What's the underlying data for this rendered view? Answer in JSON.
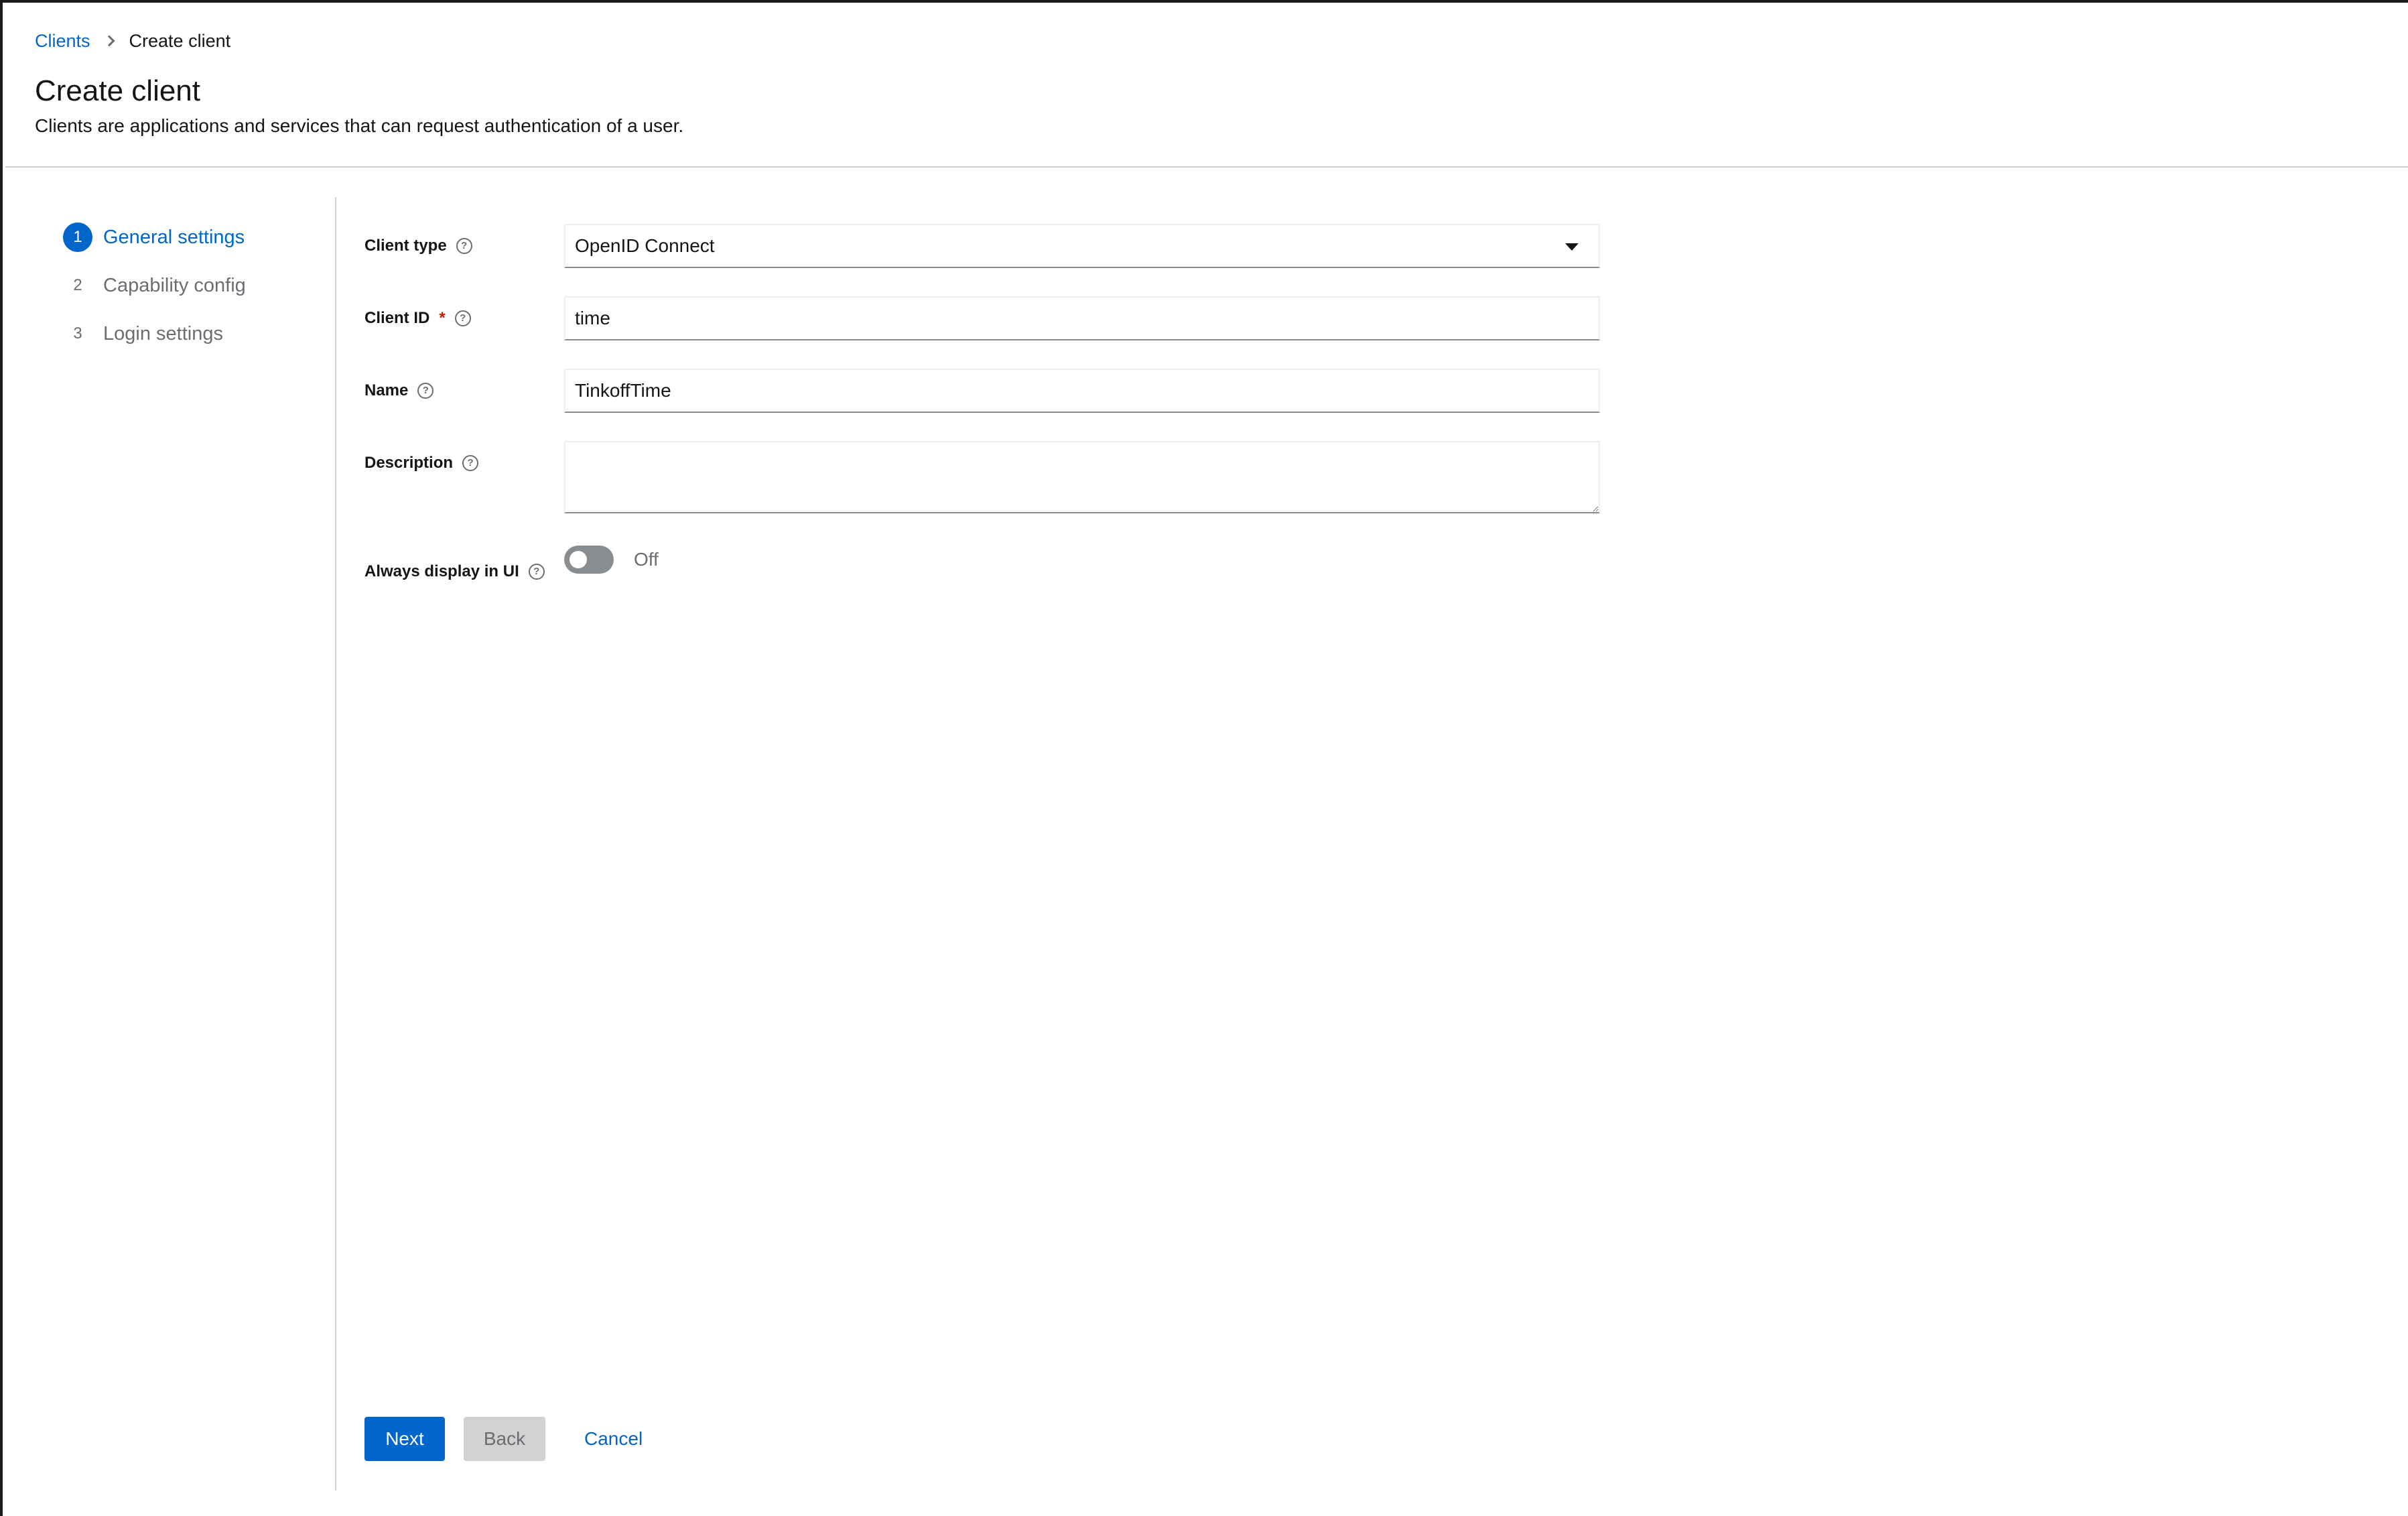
{
  "breadcrumb": {
    "parent": "Clients",
    "current": "Create client"
  },
  "header": {
    "title": "Create client",
    "subtitle": "Clients are applications and services that can request authentication of a user."
  },
  "wizard": {
    "steps": [
      {
        "number": "1",
        "label": "General settings",
        "active": true
      },
      {
        "number": "2",
        "label": "Capability config",
        "active": false
      },
      {
        "number": "3",
        "label": "Login settings",
        "active": false
      }
    ]
  },
  "form": {
    "client_type": {
      "label": "Client type",
      "value": "OpenID Connect"
    },
    "client_id": {
      "label": "Client ID",
      "required_mark": "*",
      "value": "time"
    },
    "name": {
      "label": "Name",
      "value": "TinkoffTime"
    },
    "description": {
      "label": "Description",
      "value": ""
    },
    "always_display": {
      "label": "Always display in UI",
      "state": "Off"
    },
    "help_glyph": "?"
  },
  "footer": {
    "next": "Next",
    "back": "Back",
    "cancel": "Cancel"
  },
  "colors": {
    "accent": "#0066cc",
    "required": "#c9190b",
    "border": "#d2d2d2"
  },
  "icons": {
    "breadcrumb_separator": "chevron-right-icon",
    "help": "question-circle-icon",
    "select": "caret-down-icon"
  }
}
